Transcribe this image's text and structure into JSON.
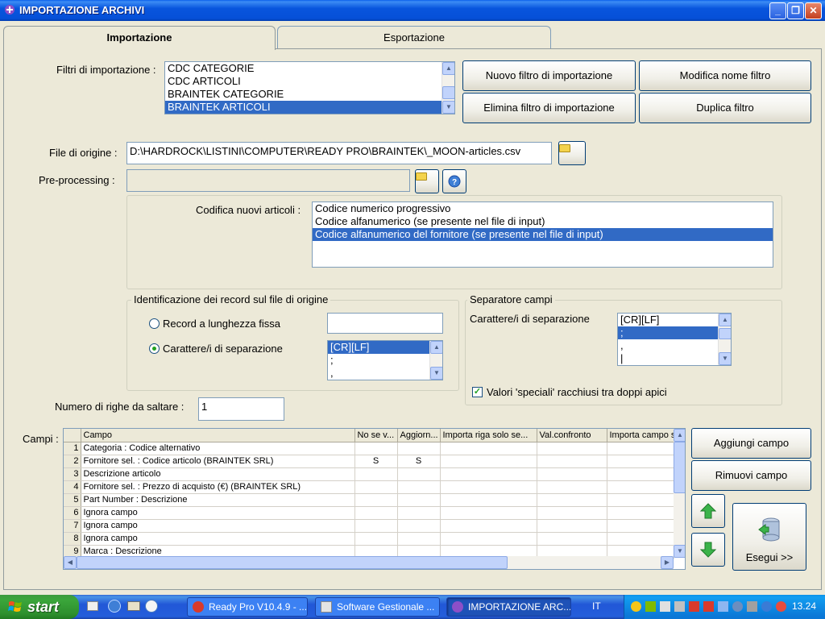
{
  "window": {
    "title": "IMPORTAZIONE ARCHIVI",
    "minimize": "_",
    "maximize": "❐",
    "close": "✕"
  },
  "tabs": [
    {
      "label": "Importazione",
      "active": true
    },
    {
      "label": "Esportazione",
      "active": false
    }
  ],
  "filters": {
    "label": "Filtri di importazione :",
    "items": [
      "CDC CATEGORIE",
      "CDC ARTICOLI",
      "BRAINTEK CATEGORIE",
      "BRAINTEK ARTICOLI"
    ],
    "selected_index": 3
  },
  "buttons": {
    "new_filter": "Nuovo filtro di importazione",
    "rename_filter": "Modifica nome filtro",
    "delete_filter": "Elimina filtro di importazione",
    "duplicate_filter": "Duplica filtro",
    "add_field": "Aggiungi campo",
    "remove_field": "Rimuovi campo",
    "execute": "Esegui >>"
  },
  "source_file": {
    "label": "File di origine :",
    "value": "D:\\HARDROCK\\LISTINI\\COMPUTER\\READY PRO\\BRAINTEK\\_MOON-articles.csv"
  },
  "preprocessing": {
    "label": "Pre-processing :",
    "value": ""
  },
  "coding": {
    "label": "Codifica nuovi articoli :",
    "items": [
      "Codice numerico progressivo",
      "Codice alfanumerico (se presente nel file di input)",
      "Codice alfanumerico del fornitore (se presente nel file di input)"
    ],
    "selected_index": 2
  },
  "record_id": {
    "title": "Identificazione dei record sul file di origine",
    "option_fixed": "Record a lunghezza fissa",
    "option_separator": "Carattere/i di separazione",
    "selected": "separator",
    "fixed_value": "",
    "separators": [
      "[CR][LF]",
      ";",
      ","
    ],
    "selected_separator_index": 0
  },
  "field_separator": {
    "title": "Separatore campi",
    "label": "Carattere/i di separazione",
    "items": [
      "[CR][LF]",
      ";",
      ",",
      "|"
    ],
    "selected_index": 1,
    "quotes_checkbox": "Valori 'speciali' racchiusi tra doppi apici",
    "quotes_checked": true
  },
  "skip_rows": {
    "label": "Numero di righe da saltare :",
    "value": "1"
  },
  "fields_grid": {
    "label": "Campi :",
    "columns": [
      "",
      "Campo",
      "No se v...",
      "Aggiorn...",
      "Importa riga solo se...",
      "Val.confronto",
      "Importa campo s"
    ],
    "rows": [
      [
        "1",
        "Categoria : Codice alternativo",
        "",
        "",
        "",
        "",
        ""
      ],
      [
        "2",
        "Fornitore sel. : Codice articolo (BRAINTEK SRL)",
        "S",
        "S",
        "",
        "",
        ""
      ],
      [
        "3",
        "Descrizione articolo",
        "",
        "",
        "",
        "",
        ""
      ],
      [
        "4",
        "Fornitore sel. : Prezzo di acquisto (€) (BRAINTEK SRL)",
        "",
        "",
        "",
        "",
        ""
      ],
      [
        "5",
        "Part Number : Descrizione",
        "",
        "",
        "",
        "",
        ""
      ],
      [
        "6",
        "Ignora campo",
        "",
        "",
        "",
        "",
        ""
      ],
      [
        "7",
        "Ignora campo",
        "",
        "",
        "",
        "",
        ""
      ],
      [
        "8",
        "Ignora campo",
        "",
        "",
        "",
        "",
        ""
      ],
      [
        "9",
        "Marca : Descrizione",
        "",
        "",
        "",
        "",
        ""
      ]
    ]
  },
  "taskbar": {
    "start": "start",
    "tasks": [
      {
        "label": "Ready Pro V10.4.9 - ...",
        "active": false
      },
      {
        "label": "Software Gestionale ...",
        "active": false
      },
      {
        "label": "IMPORTAZIONE ARC...",
        "active": true
      }
    ],
    "language": "IT",
    "clock": "13.24"
  },
  "colors": {
    "selection": "#316AC5",
    "titlebar": "#0855DD",
    "face": "#ECE9D8",
    "arrow_green": "#39A83A"
  }
}
